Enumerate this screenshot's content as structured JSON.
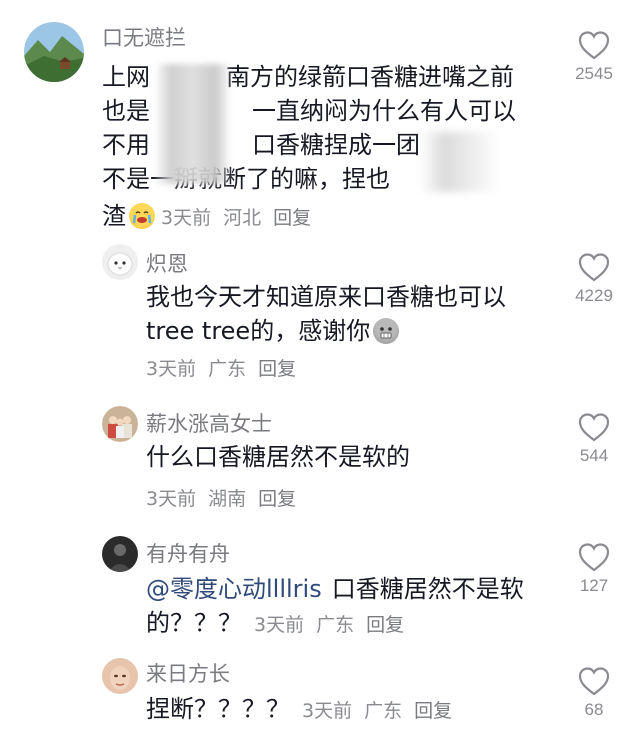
{
  "comments": [
    {
      "username": "口无遮拦",
      "lines": [
        "上网",
        "南方的绿箭口香糖进嘴之前",
        "也是",
        "一直纳闷为什么有人可以",
        "不用",
        "口香糖捏成一团",
        "不是一掰就断了的嘛，捏也",
        "渣"
      ],
      "time": "3天前",
      "location": "河北",
      "reply_label": "回复",
      "like_count": "2545",
      "emoji": "crying-face-emoji"
    },
    {
      "username": "炽恩",
      "lines": [
        "我也今天才知道原来口香糖也可以",
        "tree tree的，感谢你"
      ],
      "time": "3天前",
      "location": "广东",
      "reply_label": "回复",
      "like_count": "4229",
      "emoji": "grimace-face-emoji"
    },
    {
      "username": "薪水涨高女士",
      "lines": [
        "什么口香糖居然不是软的"
      ],
      "time": "3天前",
      "location": "湖南",
      "reply_label": "回复",
      "like_count": "544"
    },
    {
      "username": "有舟有舟",
      "mention": "@零度心动llllris",
      "lines": [
        "口香糖居然不是软",
        "的？？？"
      ],
      "time": "3天前",
      "location": "广东",
      "reply_label": "回复",
      "like_count": "127"
    },
    {
      "username": "来日方长",
      "lines": [
        "捏断？？？？"
      ],
      "time": "3天前",
      "location": "广东",
      "reply_label": "回复",
      "like_count": "68"
    }
  ],
  "colors": {
    "text": "#161823",
    "username": "#7a7b80",
    "meta": "#8a8b90",
    "mention": "#2f4a7a"
  }
}
